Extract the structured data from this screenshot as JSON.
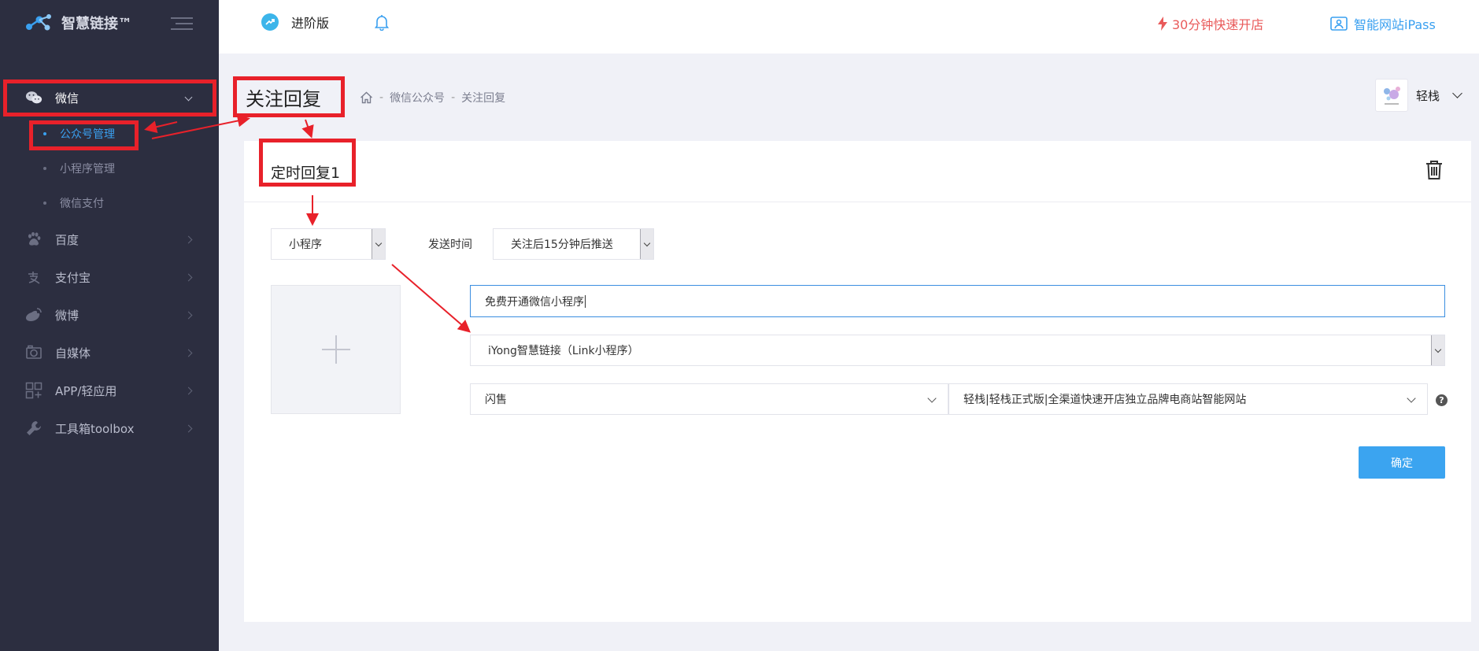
{
  "app": {
    "brand": "智慧链接™"
  },
  "sidebar": {
    "menu": [
      {
        "label": "微信",
        "icon": "wechat-icon"
      },
      {
        "label": "百度",
        "icon": "baidu-paw-icon"
      },
      {
        "label": "支付宝",
        "icon": "alipay-icon"
      },
      {
        "label": "微博",
        "icon": "weibo-icon"
      },
      {
        "label": "自媒体",
        "icon": "camera-icon"
      },
      {
        "label": "APP/轻应用",
        "icon": "apps-grid-icon"
      },
      {
        "label": "工具箱toolbox",
        "icon": "wrench-icon"
      }
    ],
    "wechat_sub": [
      {
        "label": "公众号管理"
      },
      {
        "label": "小程序管理"
      },
      {
        "label": "微信支付"
      }
    ]
  },
  "topbar": {
    "edition": "进阶版",
    "quick_open": "30分钟快速开店",
    "ipass": "智能网站iPass"
  },
  "page": {
    "title": "关注回复",
    "breadcrumb": [
      "微信公众号",
      "关注回复"
    ],
    "user_name": "轻栈"
  },
  "card": {
    "title": "定时回复1",
    "type_select": "小程序",
    "send_time_label": "发送时间",
    "send_time_select": "关注后15分钟后推送",
    "title_input_value": "免费开通微信小程序",
    "app_select": "iYong智慧链接（Link小程序）",
    "page_select": "闪售",
    "item_select": "轻栈|轻栈正式版|全渠道快速开店独立品牌电商站智能网站",
    "confirm_label": "确定"
  },
  "colors": {
    "sidebar_bg": "#2c2e40",
    "accent_blue": "#3ba4f0",
    "annotation_red": "#e8212a",
    "promo_red": "#e95a5a"
  }
}
